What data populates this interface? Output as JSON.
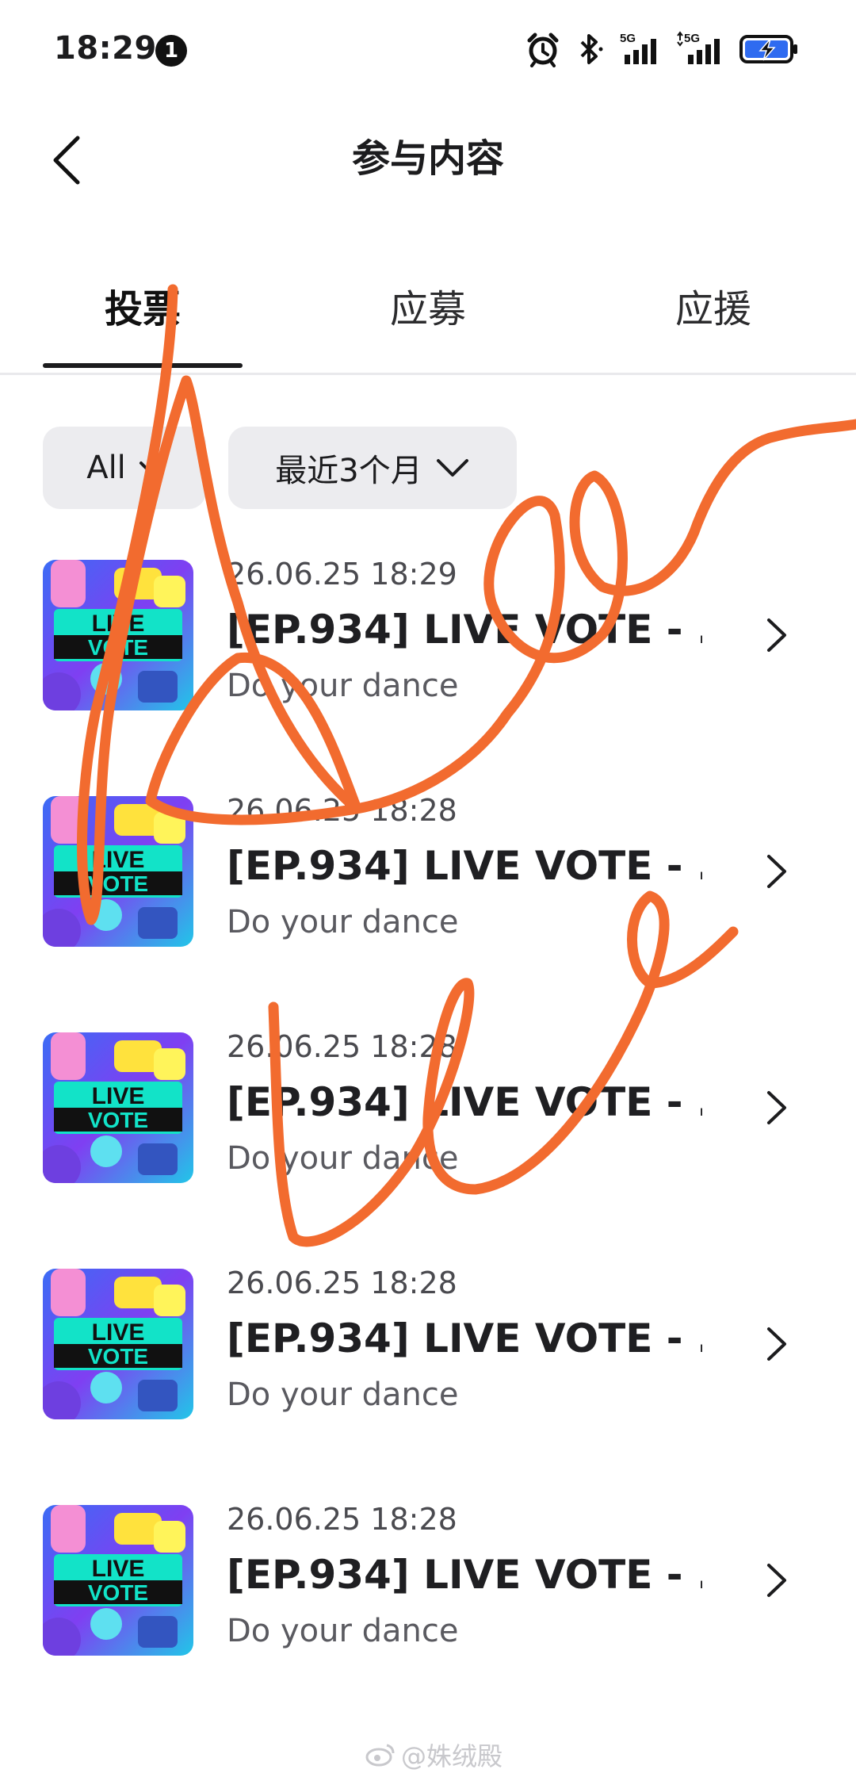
{
  "status_bar": {
    "time": "18:29",
    "notification_count": "1",
    "net1": "5G",
    "net2": "5G"
  },
  "header": {
    "title": "参与内容"
  },
  "tabs": [
    {
      "label": "投票",
      "active": true
    },
    {
      "label": "应募",
      "active": false
    },
    {
      "label": "应援",
      "active": false
    }
  ],
  "filters": {
    "category": "All",
    "period": "最近3个月"
  },
  "items": [
    {
      "date": "26.06.25 18:29",
      "title": "[EP.934] LIVE VOTE - ...",
      "subtitle": "Do your dance",
      "thumb_text": [
        "LIVE",
        "VOTE"
      ]
    },
    {
      "date": "26.06.25 18:28",
      "title": "[EP.934] LIVE VOTE - ...",
      "subtitle": "Do your dance",
      "thumb_text": [
        "LIVE",
        "VOTE"
      ]
    },
    {
      "date": "26.06.25 18:28",
      "title": "[EP.934] LIVE VOTE - ...",
      "subtitle": "Do your dance",
      "thumb_text": [
        "LIVE",
        "VOTE"
      ]
    },
    {
      "date": "26.06.25 18:28",
      "title": "[EP.934] LIVE VOTE - ...",
      "subtitle": "Do your dance",
      "thumb_text": [
        "LIVE",
        "VOTE"
      ]
    },
    {
      "date": "26.06.25 18:28",
      "title": "[EP.934] LIVE VOTE - ...",
      "subtitle": "Do your dance",
      "thumb_text": [
        "LIVE",
        "VOTE"
      ]
    }
  ],
  "watermark": "@姝绒殿",
  "colors": {
    "scribble": "#f26b2f",
    "filter_bg": "#ececef",
    "battery": "#2f6bf0"
  }
}
